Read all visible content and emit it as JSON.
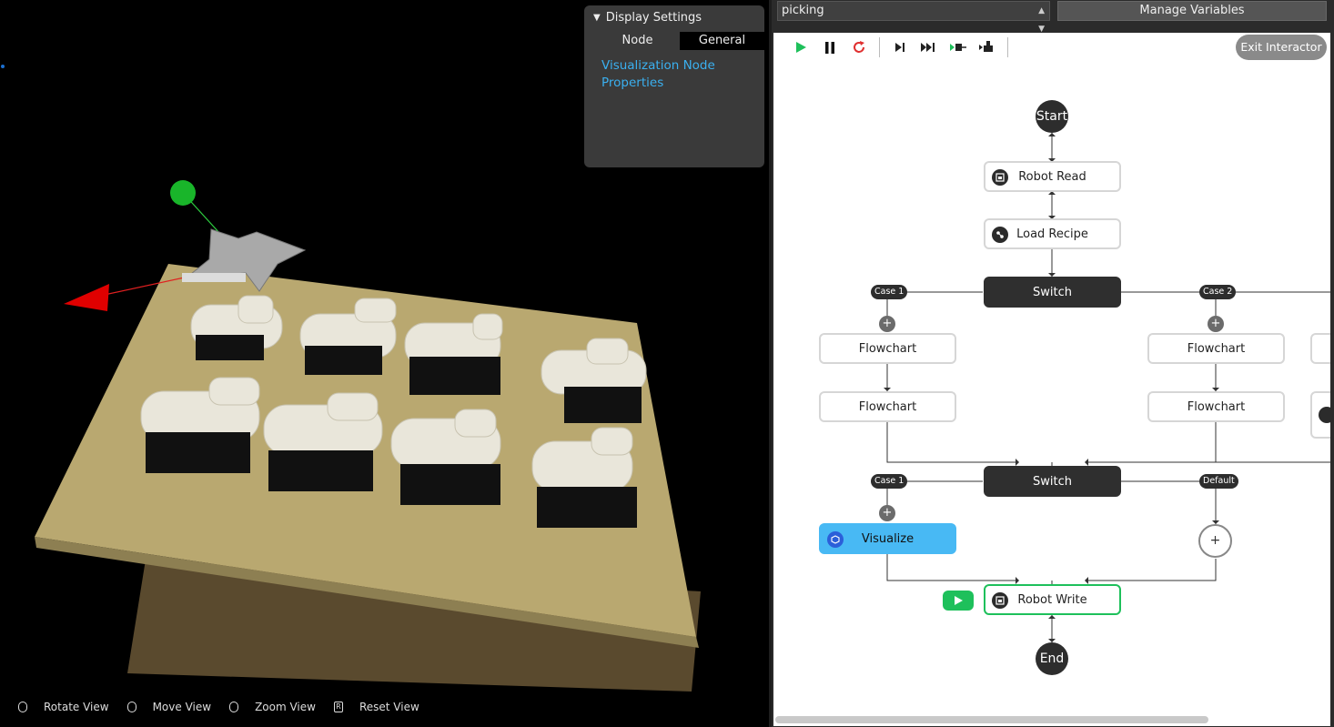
{
  "viewport": {
    "panel": {
      "title": "Display Settings",
      "tabs": [
        "Node",
        "General"
      ],
      "active_tab": "General",
      "link_text": "Visualization Node Properties"
    },
    "hints": [
      {
        "icon": "mouse-left-icon",
        "label": "Rotate View"
      },
      {
        "icon": "mouse-right-icon",
        "label": "Move View"
      },
      {
        "icon": "mouse-wheel-icon",
        "label": "Zoom View"
      },
      {
        "icon": "r-key-icon",
        "key": "R",
        "label": "Reset View"
      }
    ]
  },
  "flow": {
    "selector_value": "picking",
    "manage_label": "Manage Variables",
    "exit_label": "Exit Interactor",
    "toolbar": [
      "play-icon",
      "pause-icon",
      "restart-icon",
      "step-icon",
      "fast-forward-icon",
      "step-into-icon",
      "robot-step-icon"
    ],
    "colors": {
      "accent": "#48b9f4",
      "active": "#1ec05b",
      "dark": "#2f2f2f"
    },
    "nodes": {
      "start": "Start",
      "robot_read": "Robot Read",
      "load_recipe": "Load Recipe",
      "switch1": "Switch",
      "case1a": "Case 1",
      "case2a": "Case 2",
      "flow_a1": "Flowchart",
      "flow_a2": "Flowchart",
      "flow_b1": "Flowchart",
      "flow_b2": "Flowchart",
      "switch2": "Switch",
      "case1b": "Case 1",
      "default_b": "Default",
      "visualize": "Visualize",
      "robot_write": "Robot Write",
      "end": "End",
      "plus": "+"
    }
  }
}
